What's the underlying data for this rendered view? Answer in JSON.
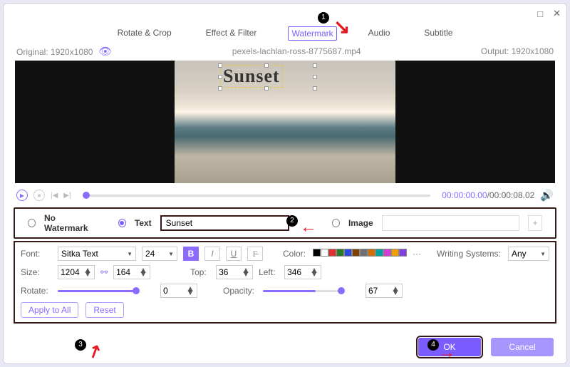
{
  "window": {
    "maximize": "□",
    "close": "✕"
  },
  "tabs": {
    "rotate": "Rotate & Crop",
    "effect": "Effect & Filter",
    "watermark": "Watermark",
    "audio": "Audio",
    "subtitle": "Subtitle"
  },
  "info": {
    "original_label": "Original:",
    "original": "1920x1080",
    "filename": "pexels-lachlan-ross-8775687.mp4",
    "output_label": "Output:",
    "output": "1920x1080"
  },
  "watermark_text": "Sunset",
  "playback": {
    "current": "00:00:00.00",
    "sep": "/",
    "duration": "00:00:08.02"
  },
  "wm": {
    "none": "No Watermark",
    "text": "Text",
    "text_value": "Sunset",
    "image": "Image"
  },
  "panel": {
    "font_label": "Font:",
    "font": "Sitka Text",
    "font_size": "24",
    "color_label": "Color:",
    "ws_label": "Writing Systems:",
    "ws": "Any",
    "size_label": "Size:",
    "w": "1204",
    "h": "164",
    "top_label": "Top:",
    "top": "36",
    "left_label": "Left:",
    "left": "346",
    "rotate_label": "Rotate:",
    "rotate": "0",
    "opacity_label": "Opacity:",
    "opacity": "67",
    "apply": "Apply to All",
    "reset": "Reset"
  },
  "footer": {
    "ok": "OK",
    "cancel": "Cancel"
  },
  "swatches": [
    "#000",
    "#fff",
    "#e03030",
    "#2a7a2a",
    "#2a4ae0",
    "#804000",
    "#707070",
    "#d07000",
    "#00a0a0",
    "#d040d0",
    "#f0a000",
    "#8040e0"
  ]
}
